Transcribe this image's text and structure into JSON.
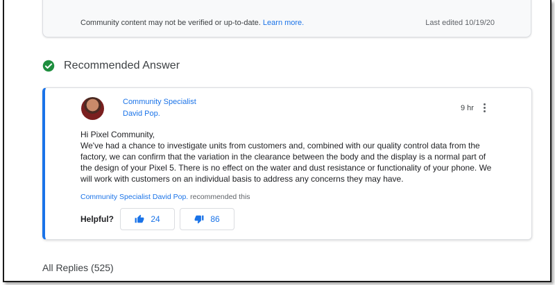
{
  "info_card": {
    "notice": "Community content may not be verified or up-to-date.",
    "learn_more": "Learn more.",
    "last_edited": "Last edited 10/19/20"
  },
  "recommended": {
    "title": "Recommended Answer"
  },
  "answer": {
    "author_role": "Community Specialist",
    "author_name": "David Pop.",
    "timestamp": "9 hr",
    "greeting": "Hi Pixel Community,",
    "body": "We've had a chance to investigate units from customers and, combined with our quality control data from the factory, we can confirm that the variation in the clearance between the body and the display is a normal part of the design of your Pixel 5. There is no effect on the water and dust resistance or functionality of your phone. We will work with customers on an individual basis to address any concerns they may have.",
    "recommended_by": "Community Specialist David Pop.",
    "recommended_suffix": " recommended this",
    "helpful_label": "Helpful?",
    "upvotes": "24",
    "downvotes": "86"
  },
  "replies": {
    "label": "All Replies (525)"
  },
  "colors": {
    "accent": "#1a73e8",
    "check_green": "#1e8e3e"
  }
}
